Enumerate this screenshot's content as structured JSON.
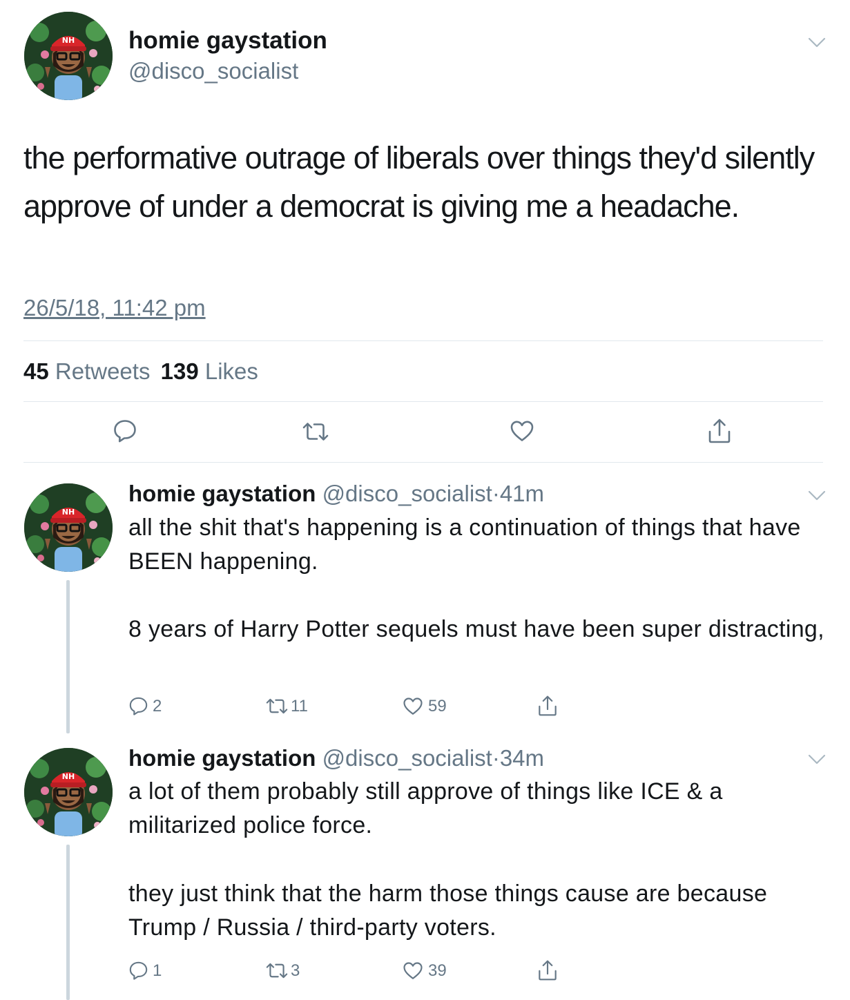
{
  "main_tweet": {
    "display_name": "homie gaystation",
    "handle": "@disco_socialist",
    "text": "the performative outrage of liberals over things they'd silently approve of under a democrat is giving me a headache.",
    "timestamp": "26/5/18, 11:42 pm",
    "retweets_count": "45",
    "retweets_label": "Retweets",
    "likes_count": "139",
    "likes_label": "Likes"
  },
  "replies": [
    {
      "display_name": "homie gaystation",
      "handle": "@disco_socialist",
      "separator": "·",
      "time": "41m",
      "paragraph1": "all the shit that's happening is a continuation of things that have BEEN happening.",
      "paragraph2": "8 years of Harry Potter sequels must have been super distracting,",
      "reply_count": "2",
      "retweet_count": "11",
      "like_count": "59"
    },
    {
      "display_name": "homie gaystation",
      "handle": "@disco_socialist",
      "separator": "·",
      "time": "34m",
      "paragraph1": "a lot of them probably still approve of things like ICE & a militarized police force.",
      "paragraph2": "they just think that the harm those things cause are because Trump / Russia / third-party voters.",
      "reply_count": "1",
      "retweet_count": "3",
      "like_count": "39"
    }
  ],
  "icons": {
    "reply": "reply-icon",
    "retweet": "retweet-icon",
    "like": "heart-icon",
    "share": "share-icon",
    "menu": "chevron-down-icon"
  },
  "colors": {
    "text": "#14171a",
    "secondary": "#657786",
    "divider": "#e1e8ed",
    "thread_line": "#ccd6dd"
  }
}
